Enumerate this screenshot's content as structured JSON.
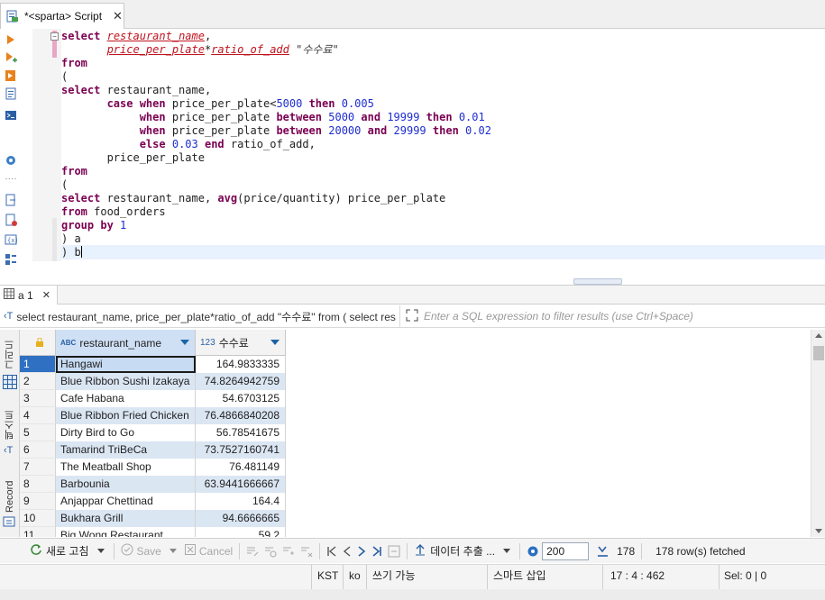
{
  "editor_tab": {
    "title": "*<sparta> Script",
    "close": "✕"
  },
  "sql": {
    "lines": [
      [
        {
          "t": "select",
          "c": "kw"
        },
        {
          "t": " "
        },
        {
          "t": "restaurant_name",
          "c": "col"
        },
        {
          "t": ","
        }
      ],
      [
        {
          "t": "       "
        },
        {
          "t": "price_per_plate",
          "c": "col"
        },
        {
          "t": "*"
        },
        {
          "t": "ratio_of_add",
          "c": "col"
        },
        {
          "t": " "
        },
        {
          "t": "\"수수료\"",
          "c": "str"
        }
      ],
      [
        {
          "t": "from",
          "c": "kw"
        }
      ],
      [
        {
          "t": "("
        }
      ],
      [
        {
          "t": "select",
          "c": "kw"
        },
        {
          "t": " restaurant_name,"
        }
      ],
      [
        {
          "t": "       "
        },
        {
          "t": "case when",
          "c": "kw"
        },
        {
          "t": " price_per_plate<"
        },
        {
          "t": "5000",
          "c": "num"
        },
        {
          "t": " "
        },
        {
          "t": "then",
          "c": "kw"
        },
        {
          "t": " "
        },
        {
          "t": "0.005",
          "c": "num"
        }
      ],
      [
        {
          "t": "            "
        },
        {
          "t": "when",
          "c": "kw"
        },
        {
          "t": " price_per_plate "
        },
        {
          "t": "between",
          "c": "kw"
        },
        {
          "t": " "
        },
        {
          "t": "5000",
          "c": "num"
        },
        {
          "t": " "
        },
        {
          "t": "and",
          "c": "kw"
        },
        {
          "t": " "
        },
        {
          "t": "19999",
          "c": "num"
        },
        {
          "t": " "
        },
        {
          "t": "then",
          "c": "kw"
        },
        {
          "t": " "
        },
        {
          "t": "0.01",
          "c": "num"
        }
      ],
      [
        {
          "t": "            "
        },
        {
          "t": "when",
          "c": "kw"
        },
        {
          "t": " price_per_plate "
        },
        {
          "t": "between",
          "c": "kw"
        },
        {
          "t": " "
        },
        {
          "t": "20000",
          "c": "num"
        },
        {
          "t": " "
        },
        {
          "t": "and",
          "c": "kw"
        },
        {
          "t": " "
        },
        {
          "t": "29999",
          "c": "num"
        },
        {
          "t": " "
        },
        {
          "t": "then",
          "c": "kw"
        },
        {
          "t": " "
        },
        {
          "t": "0.02",
          "c": "num"
        }
      ],
      [
        {
          "t": "            "
        },
        {
          "t": "else",
          "c": "kw"
        },
        {
          "t": " "
        },
        {
          "t": "0.03",
          "c": "num"
        },
        {
          "t": " "
        },
        {
          "t": "end",
          "c": "kw"
        },
        {
          "t": " ratio_of_add,"
        }
      ],
      [
        {
          "t": "       price_per_plate"
        }
      ],
      [
        {
          "t": "from",
          "c": "kw"
        }
      ],
      [
        {
          "t": "("
        }
      ],
      [
        {
          "t": "select",
          "c": "kw"
        },
        {
          "t": " restaurant_name, "
        },
        {
          "t": "avg",
          "c": "kw"
        },
        {
          "t": "(price/quantity) price_per_plate"
        }
      ],
      [
        {
          "t": "from",
          "c": "kw"
        },
        {
          "t": " food_orders"
        }
      ],
      [
        {
          "t": "group by",
          "c": "kw"
        },
        {
          "t": " "
        },
        {
          "t": "1",
          "c": "num"
        }
      ],
      [
        {
          "t": ") a"
        }
      ],
      [
        {
          "t": ") b"
        }
      ]
    ]
  },
  "results_tab": {
    "label": "a 1"
  },
  "filter": {
    "query_text": "select restaurant_name, price_per_plate*ratio_of_add \"수수료\" from ( select res",
    "placeholder": "Enter a SQL expression to filter results (use Ctrl+Space)"
  },
  "side_tabs": {
    "grid": "그리드",
    "text": "텍스트",
    "record": "Record"
  },
  "grid": {
    "columns": [
      {
        "type_badge": "ABC",
        "name": "restaurant_name"
      },
      {
        "type_badge": "123",
        "name": "수수료"
      }
    ],
    "rows": [
      {
        "n": "1",
        "name": "Hangawi",
        "fee": "164.9833335"
      },
      {
        "n": "2",
        "name": "Blue Ribbon Sushi Izakaya",
        "fee": "74.8264942759"
      },
      {
        "n": "3",
        "name": "Cafe Habana",
        "fee": "54.6703125"
      },
      {
        "n": "4",
        "name": "Blue Ribbon Fried Chicken",
        "fee": "76.4866840208"
      },
      {
        "n": "5",
        "name": "Dirty Bird to Go",
        "fee": "56.78541675"
      },
      {
        "n": "6",
        "name": "Tamarind TriBeCa",
        "fee": "73.7527160741"
      },
      {
        "n": "7",
        "name": "The Meatball Shop",
        "fee": "76.481149"
      },
      {
        "n": "8",
        "name": "Barbounia",
        "fee": "63.9441666667"
      },
      {
        "n": "9",
        "name": "Anjappar Chettinad",
        "fee": "164.4"
      },
      {
        "n": "10",
        "name": "Bukhara Grill",
        "fee": "94.6666665"
      },
      {
        "n": "11",
        "name": "Big Wong Restaurant",
        "fee": "59.2"
      }
    ]
  },
  "bottom_toolbar": {
    "refresh": "새로 고침",
    "save": "Save",
    "cancel": "Cancel",
    "export": "데이터 추출 ...",
    "fetch_size": "200",
    "fetched": "178",
    "row_count": "178 row(s) fetched"
  },
  "status_bar": {
    "timezone": "KST",
    "lang": "ko",
    "mode": "쓰기 가능",
    "insert": "스마트 삽입",
    "position": "17 : 4 : 462",
    "selection": "Sel: 0 | 0"
  },
  "colors": {
    "keyword": "#7b0052",
    "number": "#1e2dd1",
    "column": "#c0141e",
    "row_alt": "#dbe6f3",
    "row_selected": "#2f70c3",
    "accent": "#1d64a6"
  }
}
